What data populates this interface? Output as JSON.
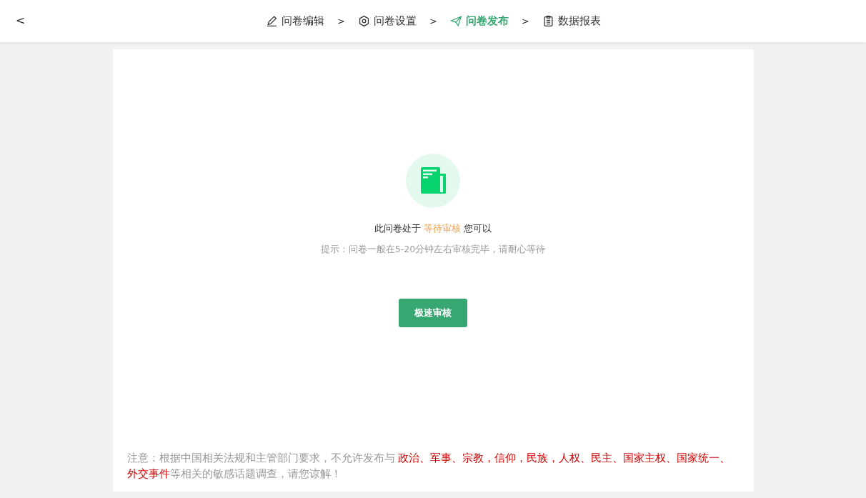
{
  "header": {
    "back": "<",
    "steps": [
      {
        "label": "问卷编辑",
        "kind": "edit",
        "selected": false
      },
      {
        "label": "问卷设置",
        "kind": "settings",
        "selected": false
      },
      {
        "label": "问卷发布",
        "kind": "publish",
        "selected": true
      },
      {
        "label": "数据报表",
        "kind": "report",
        "selected": false
      }
    ],
    "separators": [
      ">",
      ">",
      ">"
    ]
  },
  "status": {
    "prefix": "此问卷处于",
    "state": "等待审核",
    "suffix": "您可以"
  },
  "hint": "提示：问卷一般在5-20分钟左右审核完毕，请耐心等待",
  "button": "极速审核",
  "notice": [
    {
      "text": "注意：根据中国相关法规和主管部门要求，不允许发布与 ",
      "highlight": false
    },
    {
      "text": "政治、军事、宗教，信仰，民族，人权、民主、国家主权、国家统一、外交事件",
      "highlight": true
    },
    {
      "text": "等相关的敏感话题调查，请您谅解！",
      "highlight": false
    }
  ]
}
